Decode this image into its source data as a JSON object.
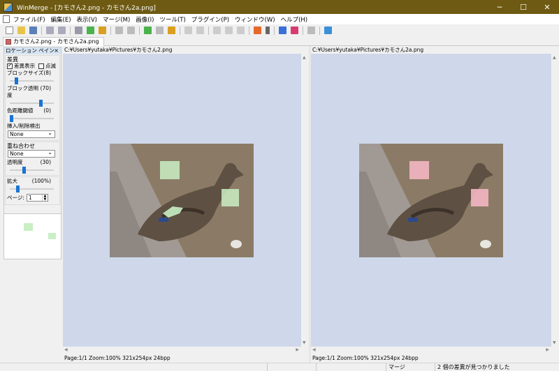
{
  "window": {
    "app_name": "WinMerge",
    "title": "WinMerge - [カモさん2.png - カモさん2a.png]",
    "minimize": "─",
    "maximize": "☐",
    "close": "✕"
  },
  "menu": [
    "ファイル(F)",
    "編集(E)",
    "表示(V)",
    "マージ(M)",
    "画像(I)",
    "ツール(T)",
    "プラグイン(P)",
    "ウィンドウ(W)",
    "ヘルプ(H)"
  ],
  "tab": {
    "label": "カモさん2.png - カモさん2a.png"
  },
  "location_pane": {
    "title": "ロケーション ペイン",
    "close": "×",
    "diff_group": {
      "title": "差異",
      "show_diff": "差異表示",
      "blink": "点滅",
      "show_diff_checked": true,
      "blink_checked": false,
      "block_size_label": "ブロックサイズ",
      "block_size_value": "(8)",
      "block_size_level": 0.12,
      "block_alpha_label": "ブロック透明度",
      "block_alpha_value": "(70)",
      "block_alpha_level": 0.7,
      "color_threshold_label": "色距離閾値",
      "color_threshold_value": "(0)",
      "color_threshold_level": 0.0,
      "insert_detect_label": "挿入/削除検出",
      "insert_detect_value": "None"
    },
    "overlay_group": {
      "title": "重ね合わせ",
      "mode_value": "None",
      "alpha_label": "透明度",
      "alpha_value": "(30)",
      "alpha_level": 0.3
    },
    "zoom_group": {
      "zoom_label": "拡大",
      "zoom_value": "(100%)",
      "zoom_level": 0.15,
      "page_label": "ページ:",
      "page_value": "1",
      "spin_up": "▲",
      "spin_down": "▼"
    }
  },
  "left_pane": {
    "path": "C:¥Users¥yutaka¥Pictures¥カモさん2.png",
    "status": "Page:1/1 Zoom:100% 321x254px 24bpp"
  },
  "right_pane": {
    "path": "C:¥Users¥yutaka¥Pictures¥カモさん2a.png",
    "status": "Page:1/1 Zoom:100% 321x254px 24bpp"
  },
  "statusbar": {
    "merge": "マージ",
    "diff_count": "2 個の差異が見つかりました"
  },
  "colors": {
    "title_bg": "#6e5a12",
    "pane_bg": "#cfd8ea",
    "diff_left": "#c9efc4",
    "diff_right": "#f3b6c2",
    "slider_thumb": "#1a74d4"
  }
}
